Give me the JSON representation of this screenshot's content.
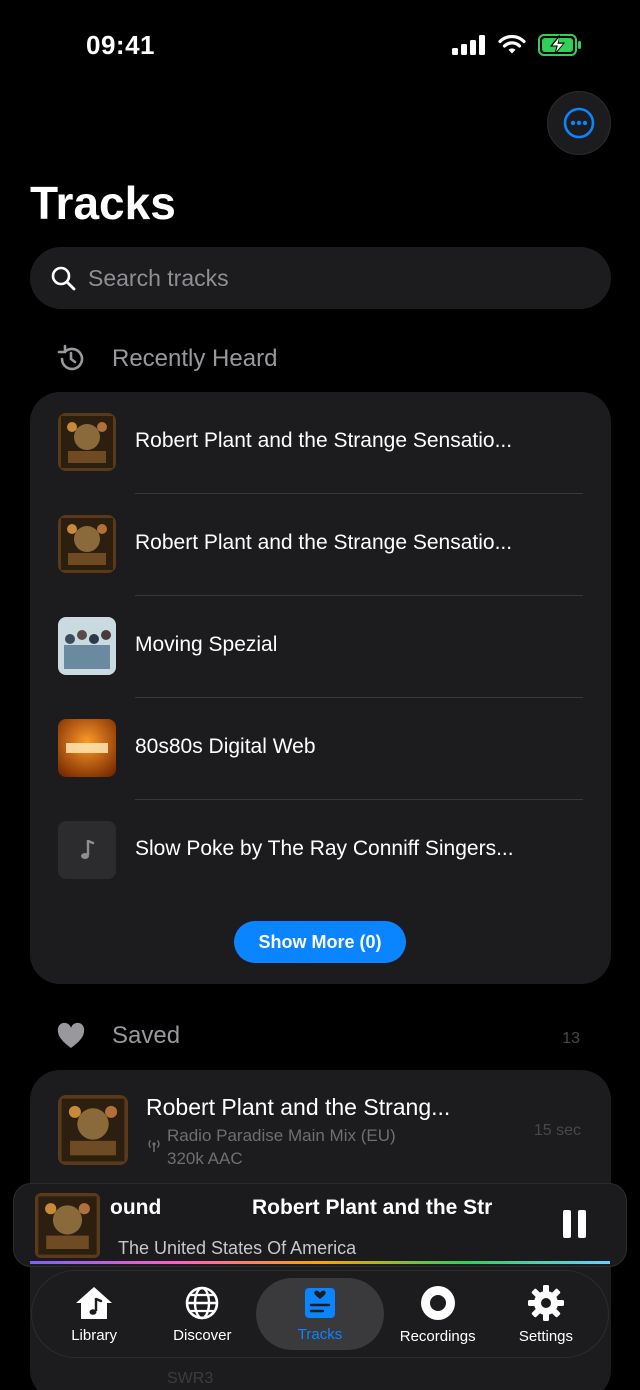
{
  "status": {
    "time": "09:41"
  },
  "page": {
    "title": "Tracks"
  },
  "search": {
    "placeholder": "Search tracks"
  },
  "recent": {
    "label": "Recently Heard",
    "items": [
      {
        "title": "Robert Plant and the Strange Sensatio...",
        "art": "led-zeppelin-art"
      },
      {
        "title": "Robert Plant and the Strange Sensatio...",
        "art": "led-zeppelin-art"
      },
      {
        "title": "Moving Spezial",
        "art": "group-photo-art"
      },
      {
        "title": "80s80s Digital Web",
        "art": "classics-art"
      },
      {
        "title": "Slow Poke by The Ray Conniff Singers...",
        "art": "music-note-placeholder"
      }
    ],
    "show_more": "Show More (0)"
  },
  "saved": {
    "label": "Saved",
    "count": "13",
    "items": [
      {
        "title": "Robert Plant and the Strang...",
        "station": "Radio Paradise Main Mix (EU)",
        "bitrate": "320k AAC",
        "duration": "15 sec"
      }
    ],
    "ghost_sub": "SWR3"
  },
  "player": {
    "scroll_a": "ound",
    "scroll_b": "Robert Plant and the Str",
    "country": "The United States Of America"
  },
  "tabs": [
    {
      "label": "Library",
      "icon": "house-music-icon"
    },
    {
      "label": "Discover",
      "icon": "globe-icon"
    },
    {
      "label": "Tracks",
      "icon": "tracks-list-icon",
      "active": true
    },
    {
      "label": "Recordings",
      "icon": "record-icon"
    },
    {
      "label": "Settings",
      "icon": "gear-icon"
    }
  ],
  "colors": {
    "accent": "#0a84ff",
    "card": "#1c1c1e",
    "background": "#000000"
  }
}
